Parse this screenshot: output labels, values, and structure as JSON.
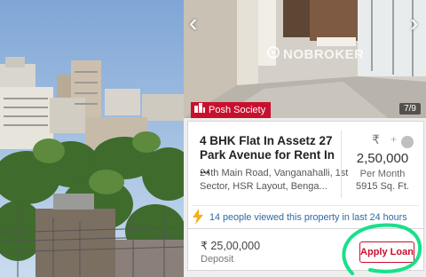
{
  "gallery": {
    "badge_label": "Posh Society",
    "photo_counter": "7/9",
    "watermark": "NOBROKER"
  },
  "listing": {
    "title": "4 BHK Flat In Assetz 27 Park Avenue for Rent In ...",
    "address": "24th Main Road, Vanganahalli, 1st Sector, HSR Layout, Benga...",
    "currency_symbol": "₹",
    "rent": "2,50,000",
    "rent_period": "Per Month",
    "area": "5915 Sq. Ft.",
    "views_text": "14 people viewed this property in last 24 hours"
  },
  "deposit": {
    "amount": "₹ 25,00,000",
    "label": "Deposit",
    "apply_label": "Apply Loan"
  },
  "colors": {
    "accent": "#c8102e",
    "link": "#2d6aa3",
    "annotation": "#19e08a"
  }
}
